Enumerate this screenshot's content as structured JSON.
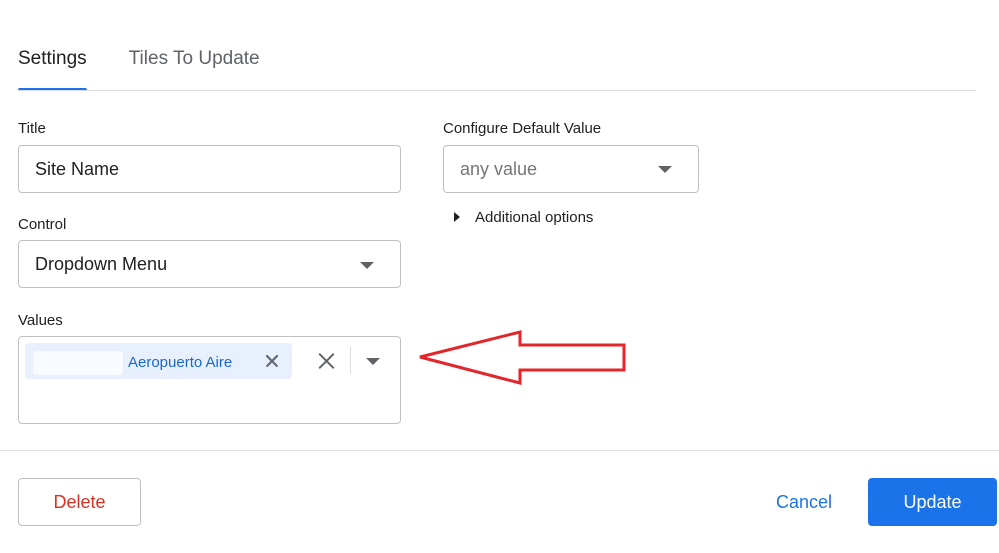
{
  "tabs": [
    {
      "label": "Settings",
      "active": true
    },
    {
      "label": "Tiles To Update",
      "active": false
    }
  ],
  "form": {
    "title_label": "Title",
    "title_value": "Site Name",
    "control_label": "Control",
    "control_value": "Dropdown Menu",
    "values_label": "Values",
    "values_chip": "Aeropuerto Aire",
    "default_label": "Configure Default Value",
    "default_placeholder": "any value",
    "additional_options": "Additional options"
  },
  "footer": {
    "delete_label": "Delete",
    "cancel_label": "Cancel",
    "update_label": "Update"
  },
  "colors": {
    "accent": "#1a73e8",
    "danger": "#d93025",
    "annotation_arrow": "#e3262b"
  }
}
